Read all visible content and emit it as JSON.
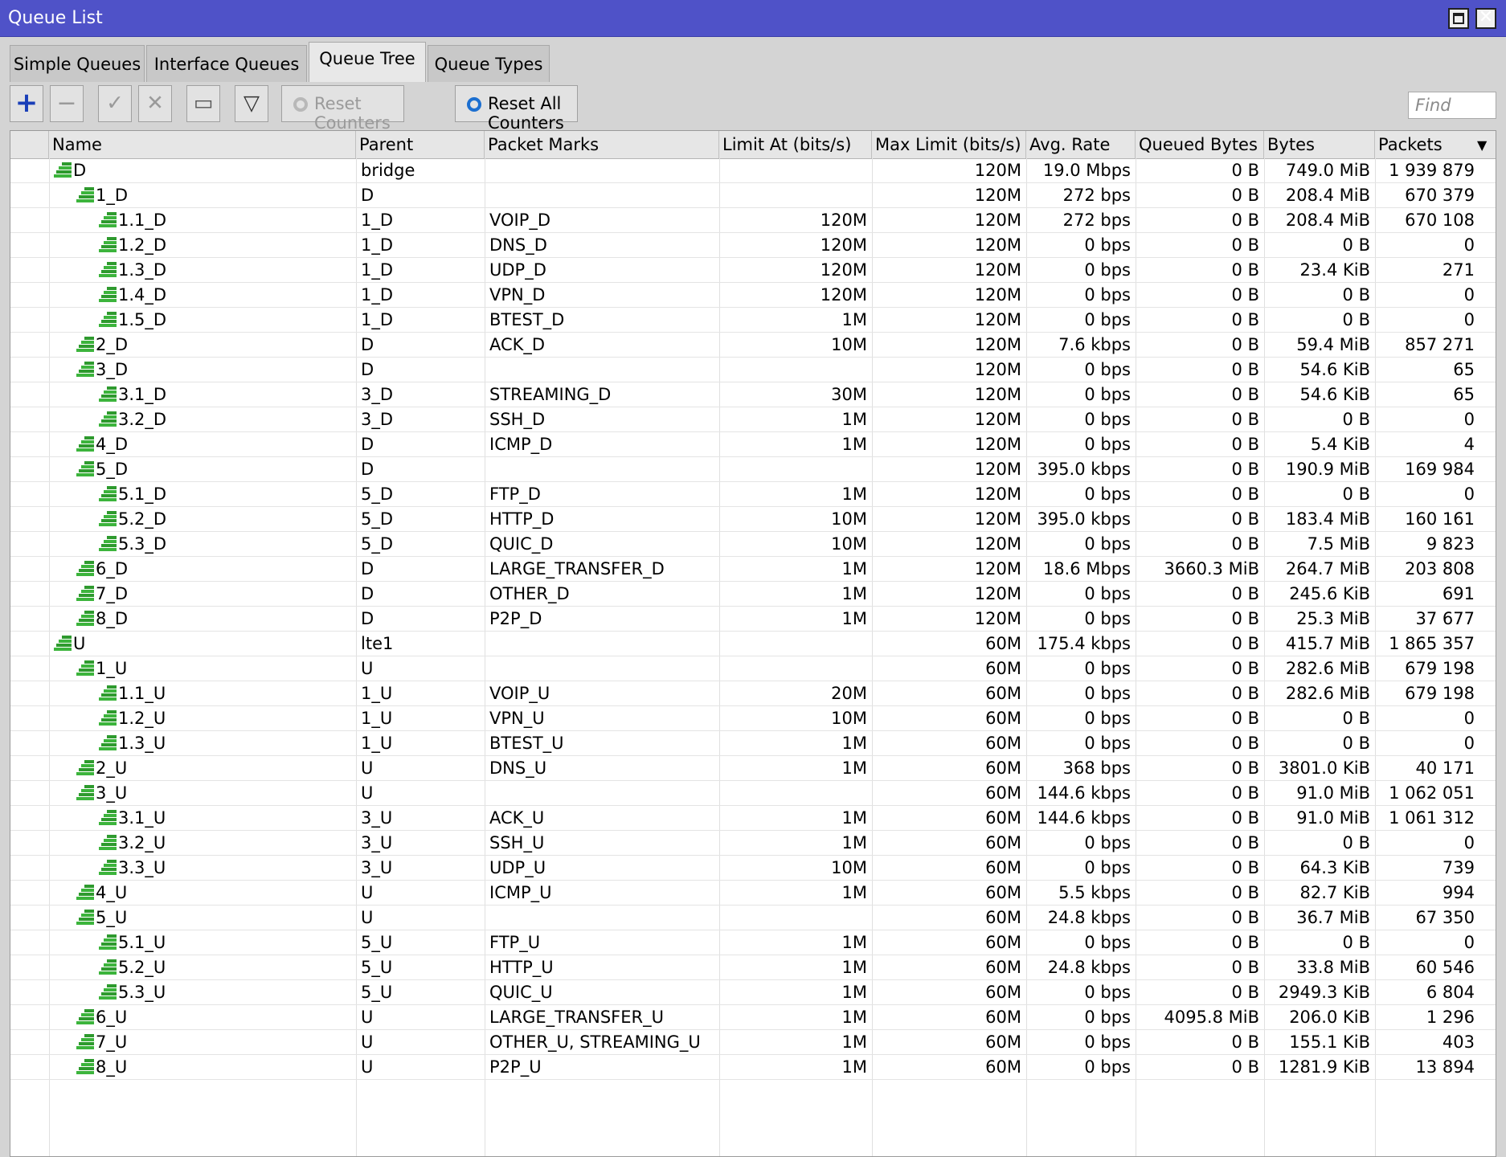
{
  "window": {
    "title": "Queue List",
    "close_label": "✕"
  },
  "tabs": [
    {
      "label": "Simple Queues",
      "active": false
    },
    {
      "label": "Interface Queues",
      "active": false
    },
    {
      "label": "Queue Tree",
      "active": true
    },
    {
      "label": "Queue Types",
      "active": false
    }
  ],
  "toolbar": {
    "add_icon": "+",
    "remove_icon": "−",
    "enable_icon": "✓",
    "disable_icon": "✕",
    "comment_icon": "▭",
    "filter_icon": "▽",
    "reset_counters": "Reset Counters",
    "reset_all_counters": "Reset All Counters",
    "find_placeholder": "Find"
  },
  "columns": [
    "Name",
    "Parent",
    "Packet Marks",
    "Limit At (bits/s)",
    "Max Limit (bits/s)",
    "Avg. Rate",
    "Queued Bytes",
    "Bytes",
    "Packets"
  ],
  "sort_icon": "▲",
  "col_menu_icon": "▼",
  "rows": [
    {
      "level": 0,
      "name": "D",
      "parent": "bridge",
      "marks": "",
      "limit_at": "",
      "max_limit": "120M",
      "avg_rate": "19.0 Mbps",
      "queued": "0 B",
      "bytes": "749.0 MiB",
      "packets": "1 939 879"
    },
    {
      "level": 1,
      "name": "1_D",
      "parent": "D",
      "marks": "",
      "limit_at": "",
      "max_limit": "120M",
      "avg_rate": "272 bps",
      "queued": "0 B",
      "bytes": "208.4 MiB",
      "packets": "670 379"
    },
    {
      "level": 2,
      "name": "1.1_D",
      "parent": "1_D",
      "marks": "VOIP_D",
      "limit_at": "120M",
      "max_limit": "120M",
      "avg_rate": "272 bps",
      "queued": "0 B",
      "bytes": "208.4 MiB",
      "packets": "670 108"
    },
    {
      "level": 2,
      "name": "1.2_D",
      "parent": "1_D",
      "marks": "DNS_D",
      "limit_at": "120M",
      "max_limit": "120M",
      "avg_rate": "0 bps",
      "queued": "0 B",
      "bytes": "0 B",
      "packets": "0"
    },
    {
      "level": 2,
      "name": "1.3_D",
      "parent": "1_D",
      "marks": "UDP_D",
      "limit_at": "120M",
      "max_limit": "120M",
      "avg_rate": "0 bps",
      "queued": "0 B",
      "bytes": "23.4 KiB",
      "packets": "271"
    },
    {
      "level": 2,
      "name": "1.4_D",
      "parent": "1_D",
      "marks": "VPN_D",
      "limit_at": "120M",
      "max_limit": "120M",
      "avg_rate": "0 bps",
      "queued": "0 B",
      "bytes": "0 B",
      "packets": "0"
    },
    {
      "level": 2,
      "name": "1.5_D",
      "parent": "1_D",
      "marks": "BTEST_D",
      "limit_at": "1M",
      "max_limit": "120M",
      "avg_rate": "0 bps",
      "queued": "0 B",
      "bytes": "0 B",
      "packets": "0"
    },
    {
      "level": 1,
      "name": "2_D",
      "parent": "D",
      "marks": "ACK_D",
      "limit_at": "10M",
      "max_limit": "120M",
      "avg_rate": "7.6 kbps",
      "queued": "0 B",
      "bytes": "59.4 MiB",
      "packets": "857 271"
    },
    {
      "level": 1,
      "name": "3_D",
      "parent": "D",
      "marks": "",
      "limit_at": "",
      "max_limit": "120M",
      "avg_rate": "0 bps",
      "queued": "0 B",
      "bytes": "54.6 KiB",
      "packets": "65"
    },
    {
      "level": 2,
      "name": "3.1_D",
      "parent": "3_D",
      "marks": "STREAMING_D",
      "limit_at": "30M",
      "max_limit": "120M",
      "avg_rate": "0 bps",
      "queued": "0 B",
      "bytes": "54.6 KiB",
      "packets": "65"
    },
    {
      "level": 2,
      "name": "3.2_D",
      "parent": "3_D",
      "marks": "SSH_D",
      "limit_at": "1M",
      "max_limit": "120M",
      "avg_rate": "0 bps",
      "queued": "0 B",
      "bytes": "0 B",
      "packets": "0"
    },
    {
      "level": 1,
      "name": "4_D",
      "parent": "D",
      "marks": "ICMP_D",
      "limit_at": "1M",
      "max_limit": "120M",
      "avg_rate": "0 bps",
      "queued": "0 B",
      "bytes": "5.4 KiB",
      "packets": "4"
    },
    {
      "level": 1,
      "name": "5_D",
      "parent": "D",
      "marks": "",
      "limit_at": "",
      "max_limit": "120M",
      "avg_rate": "395.0 kbps",
      "queued": "0 B",
      "bytes": "190.9 MiB",
      "packets": "169 984"
    },
    {
      "level": 2,
      "name": "5.1_D",
      "parent": "5_D",
      "marks": "FTP_D",
      "limit_at": "1M",
      "max_limit": "120M",
      "avg_rate": "0 bps",
      "queued": "0 B",
      "bytes": "0 B",
      "packets": "0"
    },
    {
      "level": 2,
      "name": "5.2_D",
      "parent": "5_D",
      "marks": "HTTP_D",
      "limit_at": "10M",
      "max_limit": "120M",
      "avg_rate": "395.0 kbps",
      "queued": "0 B",
      "bytes": "183.4 MiB",
      "packets": "160 161"
    },
    {
      "level": 2,
      "name": "5.3_D",
      "parent": "5_D",
      "marks": "QUIC_D",
      "limit_at": "10M",
      "max_limit": "120M",
      "avg_rate": "0 bps",
      "queued": "0 B",
      "bytes": "7.5 MiB",
      "packets": "9 823"
    },
    {
      "level": 1,
      "name": "6_D",
      "parent": "D",
      "marks": "LARGE_TRANSFER_D",
      "limit_at": "1M",
      "max_limit": "120M",
      "avg_rate": "18.6 Mbps",
      "queued": "3660.3 MiB",
      "bytes": "264.7 MiB",
      "packets": "203 808"
    },
    {
      "level": 1,
      "name": "7_D",
      "parent": "D",
      "marks": "OTHER_D",
      "limit_at": "1M",
      "max_limit": "120M",
      "avg_rate": "0 bps",
      "queued": "0 B",
      "bytes": "245.6 KiB",
      "packets": "691"
    },
    {
      "level": 1,
      "name": "8_D",
      "parent": "D",
      "marks": "P2P_D",
      "limit_at": "1M",
      "max_limit": "120M",
      "avg_rate": "0 bps",
      "queued": "0 B",
      "bytes": "25.3 MiB",
      "packets": "37 677"
    },
    {
      "level": 0,
      "name": "U",
      "parent": "lte1",
      "marks": "",
      "limit_at": "",
      "max_limit": "60M",
      "avg_rate": "175.4 kbps",
      "queued": "0 B",
      "bytes": "415.7 MiB",
      "packets": "1 865 357"
    },
    {
      "level": 1,
      "name": "1_U",
      "parent": "U",
      "marks": "",
      "limit_at": "",
      "max_limit": "60M",
      "avg_rate": "0 bps",
      "queued": "0 B",
      "bytes": "282.6 MiB",
      "packets": "679 198"
    },
    {
      "level": 2,
      "name": "1.1_U",
      "parent": "1_U",
      "marks": "VOIP_U",
      "limit_at": "20M",
      "max_limit": "60M",
      "avg_rate": "0 bps",
      "queued": "0 B",
      "bytes": "282.6 MiB",
      "packets": "679 198"
    },
    {
      "level": 2,
      "name": "1.2_U",
      "parent": "1_U",
      "marks": "VPN_U",
      "limit_at": "10M",
      "max_limit": "60M",
      "avg_rate": "0 bps",
      "queued": "0 B",
      "bytes": "0 B",
      "packets": "0"
    },
    {
      "level": 2,
      "name": "1.3_U",
      "parent": "1_U",
      "marks": "BTEST_U",
      "limit_at": "1M",
      "max_limit": "60M",
      "avg_rate": "0 bps",
      "queued": "0 B",
      "bytes": "0 B",
      "packets": "0"
    },
    {
      "level": 1,
      "name": "2_U",
      "parent": "U",
      "marks": "DNS_U",
      "limit_at": "1M",
      "max_limit": "60M",
      "avg_rate": "368 bps",
      "queued": "0 B",
      "bytes": "3801.0 KiB",
      "packets": "40 171"
    },
    {
      "level": 1,
      "name": "3_U",
      "parent": "U",
      "marks": "",
      "limit_at": "",
      "max_limit": "60M",
      "avg_rate": "144.6 kbps",
      "queued": "0 B",
      "bytes": "91.0 MiB",
      "packets": "1 062 051"
    },
    {
      "level": 2,
      "name": "3.1_U",
      "parent": "3_U",
      "marks": "ACK_U",
      "limit_at": "1M",
      "max_limit": "60M",
      "avg_rate": "144.6 kbps",
      "queued": "0 B",
      "bytes": "91.0 MiB",
      "packets": "1 061 312"
    },
    {
      "level": 2,
      "name": "3.2_U",
      "parent": "3_U",
      "marks": "SSH_U",
      "limit_at": "1M",
      "max_limit": "60M",
      "avg_rate": "0 bps",
      "queued": "0 B",
      "bytes": "0 B",
      "packets": "0"
    },
    {
      "level": 2,
      "name": "3.3_U",
      "parent": "3_U",
      "marks": "UDP_U",
      "limit_at": "10M",
      "max_limit": "60M",
      "avg_rate": "0 bps",
      "queued": "0 B",
      "bytes": "64.3 KiB",
      "packets": "739"
    },
    {
      "level": 1,
      "name": "4_U",
      "parent": "U",
      "marks": "ICMP_U",
      "limit_at": "1M",
      "max_limit": "60M",
      "avg_rate": "5.5 kbps",
      "queued": "0 B",
      "bytes": "82.7 KiB",
      "packets": "994"
    },
    {
      "level": 1,
      "name": "5_U",
      "parent": "U",
      "marks": "",
      "limit_at": "",
      "max_limit": "60M",
      "avg_rate": "24.8 kbps",
      "queued": "0 B",
      "bytes": "36.7 MiB",
      "packets": "67 350"
    },
    {
      "level": 2,
      "name": "5.1_U",
      "parent": "5_U",
      "marks": "FTP_U",
      "limit_at": "1M",
      "max_limit": "60M",
      "avg_rate": "0 bps",
      "queued": "0 B",
      "bytes": "0 B",
      "packets": "0"
    },
    {
      "level": 2,
      "name": "5.2_U",
      "parent": "5_U",
      "marks": "HTTP_U",
      "limit_at": "1M",
      "max_limit": "60M",
      "avg_rate": "24.8 kbps",
      "queued": "0 B",
      "bytes": "33.8 MiB",
      "packets": "60 546"
    },
    {
      "level": 2,
      "name": "5.3_U",
      "parent": "5_U",
      "marks": "QUIC_U",
      "limit_at": "1M",
      "max_limit": "60M",
      "avg_rate": "0 bps",
      "queued": "0 B",
      "bytes": "2949.3 KiB",
      "packets": "6 804"
    },
    {
      "level": 1,
      "name": "6_U",
      "parent": "U",
      "marks": "LARGE_TRANSFER_U",
      "limit_at": "1M",
      "max_limit": "60M",
      "avg_rate": "0 bps",
      "queued": "4095.8 MiB",
      "bytes": "206.0 KiB",
      "packets": "1 296"
    },
    {
      "level": 1,
      "name": "7_U",
      "parent": "U",
      "marks": "OTHER_U, STREAMING_U",
      "limit_at": "1M",
      "max_limit": "60M",
      "avg_rate": "0 bps",
      "queued": "0 B",
      "bytes": "155.1 KiB",
      "packets": "403"
    },
    {
      "level": 1,
      "name": "8_U",
      "parent": "U",
      "marks": "P2P_U",
      "limit_at": "1M",
      "max_limit": "60M",
      "avg_rate": "0 bps",
      "queued": "0 B",
      "bytes": "1281.9 KiB",
      "packets": "13 894"
    }
  ]
}
